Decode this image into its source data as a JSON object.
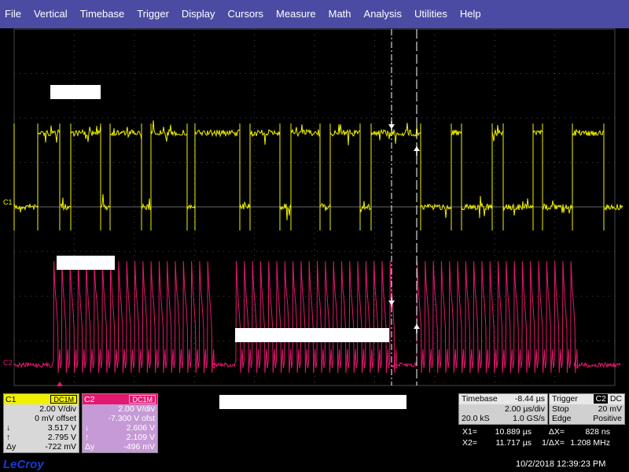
{
  "menu": [
    "File",
    "Vertical",
    "Timebase",
    "Trigger",
    "Display",
    "Cursors",
    "Measure",
    "Math",
    "Analysis",
    "Utilities",
    "Help"
  ],
  "colors": {
    "ch1": "#f0f000",
    "ch2": "#e3186f",
    "grid": "#4a4a4a",
    "menu_bg": "#4b4ba3"
  },
  "waveforms": {
    "c1_label": "C1",
    "c2_label": "C2"
  },
  "ch1": {
    "name": "C1",
    "coupling": "DC1M",
    "vdiv": "2.00 V/div",
    "offset": "0 mV offset",
    "down_sym": "↓",
    "up_sym": "↑",
    "dy_sym": "Δy",
    "down_val": "3.517 V",
    "up_val": "2.795 V",
    "dy_val": "-722 mV"
  },
  "ch2": {
    "name": "C2",
    "coupling": "DC1M",
    "vdiv": "2.00 V/div",
    "offset": "-7.300 V ofst",
    "down_sym": "↓",
    "up_sym": "↑",
    "dy_sym": "Δy",
    "down_val": "2.606 V",
    "up_val": "2.109 V",
    "dy_val": "-496 mV"
  },
  "timebase": {
    "title": "Timebase",
    "delay": "-8.44 µs",
    "tdiv": "2.00 µs/div",
    "samples": "20.0 kS",
    "rate": "1.0 GS/s"
  },
  "trigger": {
    "title": "Trigger",
    "source": "C2",
    "coupling": "DC",
    "mode": "Stop",
    "level": "20 mV",
    "type": "Edge",
    "slope": "Positive"
  },
  "cursors": {
    "x1_label": "X1=",
    "x1_val": "10.889 µs",
    "dx_label": "ΔX=",
    "dx_val": "828 ns",
    "x2_label": "X2=",
    "x2_val": "11.717 µs",
    "inv_label": "1/ΔX=",
    "inv_val": "1.208 MHz"
  },
  "brand": "LeCroy",
  "datetime": "10/2/2018 12:39:23 PM"
}
